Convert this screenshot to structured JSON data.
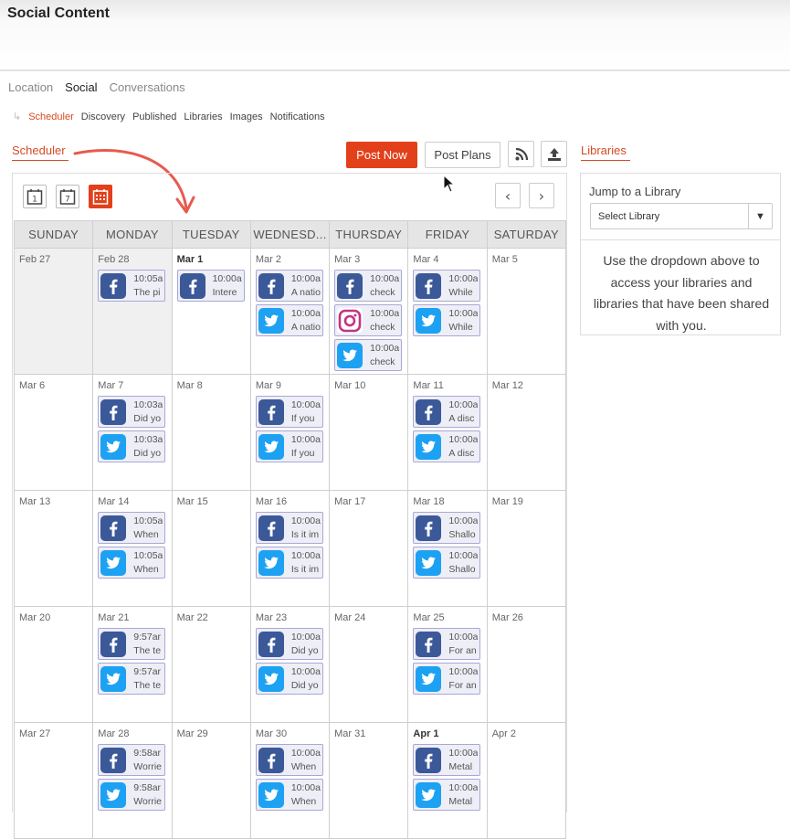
{
  "app": {
    "title": "Social Content"
  },
  "nav": {
    "primary": [
      "Location",
      "Social",
      "Conversations"
    ],
    "secondary": [
      "Scheduler",
      "Discovery",
      "Published",
      "Libraries",
      "Images",
      "Notifications"
    ]
  },
  "toolbar": {
    "section_title": "Scheduler",
    "post_now": "Post Now",
    "post_plans": "Post Plans",
    "view_day_number": "1",
    "view_week_number": "7"
  },
  "calendar": {
    "days": [
      "SUNDAY",
      "MONDAY",
      "TUESDAY",
      "WEDNESD...",
      "THURSDAY",
      "FRIDAY",
      "SATURDAY"
    ],
    "weeks": [
      [
        {
          "date": "Feb 27",
          "posts": []
        },
        {
          "date": "Feb 28",
          "posts": [
            {
              "net": "fb",
              "time": "10:05a",
              "text": "The pi"
            }
          ]
        },
        {
          "date": "Mar 1",
          "bold": true,
          "posts": [
            {
              "net": "fb",
              "time": "10:00a",
              "text": "Intere"
            }
          ]
        },
        {
          "date": "Mar 2",
          "posts": [
            {
              "net": "fb",
              "time": "10:00a",
              "text": "A natio"
            },
            {
              "net": "tw",
              "time": "10:00a",
              "text": "A natio"
            }
          ]
        },
        {
          "date": "Mar 3",
          "posts": [
            {
              "net": "fb",
              "time": "10:00a",
              "text": "check"
            },
            {
              "net": "ig",
              "time": "10:00a",
              "text": "check"
            },
            {
              "net": "tw",
              "time": "10:00a",
              "text": "check"
            }
          ]
        },
        {
          "date": "Mar 4",
          "posts": [
            {
              "net": "fb",
              "time": "10:00a",
              "text": "While"
            },
            {
              "net": "tw",
              "time": "10:00a",
              "text": "While"
            }
          ]
        },
        {
          "date": "Mar 5",
          "posts": []
        }
      ],
      [
        {
          "date": "Mar 6",
          "posts": []
        },
        {
          "date": "Mar 7",
          "posts": [
            {
              "net": "fb",
              "time": "10:03a",
              "text": "Did yo"
            },
            {
              "net": "tw",
              "time": "10:03a",
              "text": "Did yo"
            }
          ]
        },
        {
          "date": "Mar 8",
          "posts": []
        },
        {
          "date": "Mar 9",
          "posts": [
            {
              "net": "fb",
              "time": "10:00a",
              "text": "If you"
            },
            {
              "net": "tw",
              "time": "10:00a",
              "text": "If you"
            }
          ]
        },
        {
          "date": "Mar 10",
          "posts": []
        },
        {
          "date": "Mar 11",
          "posts": [
            {
              "net": "fb",
              "time": "10:00a",
              "text": "A disc"
            },
            {
              "net": "tw",
              "time": "10:00a",
              "text": "A disc"
            }
          ]
        },
        {
          "date": "Mar 12",
          "posts": []
        }
      ],
      [
        {
          "date": "Mar 13",
          "posts": []
        },
        {
          "date": "Mar 14",
          "posts": [
            {
              "net": "fb",
              "time": "10:05a",
              "text": "When"
            },
            {
              "net": "tw",
              "time": "10:05a",
              "text": "When"
            }
          ]
        },
        {
          "date": "Mar 15",
          "posts": []
        },
        {
          "date": "Mar 16",
          "posts": [
            {
              "net": "fb",
              "time": "10:00a",
              "text": "Is it im"
            },
            {
              "net": "tw",
              "time": "10:00a",
              "text": "Is it im"
            }
          ]
        },
        {
          "date": "Mar 17",
          "posts": []
        },
        {
          "date": "Mar 18",
          "posts": [
            {
              "net": "fb",
              "time": "10:00a",
              "text": "Shallo"
            },
            {
              "net": "tw",
              "time": "10:00a",
              "text": "Shallo"
            }
          ]
        },
        {
          "date": "Mar 19",
          "posts": []
        }
      ],
      [
        {
          "date": "Mar 20",
          "posts": []
        },
        {
          "date": "Mar 21",
          "posts": [
            {
              "net": "fb",
              "time": "9:57ar",
              "text": "The te"
            },
            {
              "net": "tw",
              "time": "9:57ar",
              "text": "The te"
            }
          ]
        },
        {
          "date": "Mar 22",
          "posts": []
        },
        {
          "date": "Mar 23",
          "posts": [
            {
              "net": "fb",
              "time": "10:00a",
              "text": "Did yo"
            },
            {
              "net": "tw",
              "time": "10:00a",
              "text": "Did yo"
            }
          ]
        },
        {
          "date": "Mar 24",
          "posts": []
        },
        {
          "date": "Mar 25",
          "posts": [
            {
              "net": "fb",
              "time": "10:00a",
              "text": "For an"
            },
            {
              "net": "tw",
              "time": "10:00a",
              "text": "For an"
            }
          ]
        },
        {
          "date": "Mar 26",
          "posts": []
        }
      ],
      [
        {
          "date": "Mar 27",
          "posts": []
        },
        {
          "date": "Mar 28",
          "posts": [
            {
              "net": "fb",
              "time": "9:58ar",
              "text": "Worrie"
            },
            {
              "net": "tw",
              "time": "9:58ar",
              "text": "Worrie"
            }
          ]
        },
        {
          "date": "Mar 29",
          "posts": []
        },
        {
          "date": "Mar 30",
          "posts": [
            {
              "net": "fb",
              "time": "10:00a",
              "text": "When"
            },
            {
              "net": "tw",
              "time": "10:00a",
              "text": "When"
            }
          ]
        },
        {
          "date": "Mar 31",
          "posts": []
        },
        {
          "date": "Apr 1",
          "bold": true,
          "posts": [
            {
              "net": "fb",
              "time": "10:00a",
              "text": "Metal"
            },
            {
              "net": "tw",
              "time": "10:00a",
              "text": "Metal"
            }
          ]
        },
        {
          "date": "Apr 2",
          "posts": []
        }
      ]
    ]
  },
  "libraries": {
    "title": "Libraries",
    "jump_label": "Jump to a Library",
    "select_value": "Select Library",
    "help_text": "Use the dropdown above to access your libraries and libraries that have been shared with you."
  },
  "colors": {
    "accent": "#e2401b",
    "facebook": "#3b5998",
    "twitter": "#1da1f2",
    "instagram": "#c13584"
  },
  "icons": {
    "rss": "rss-icon",
    "upload": "upload-icon",
    "prev": "chevron-left-icon",
    "next": "chevron-right-icon"
  }
}
